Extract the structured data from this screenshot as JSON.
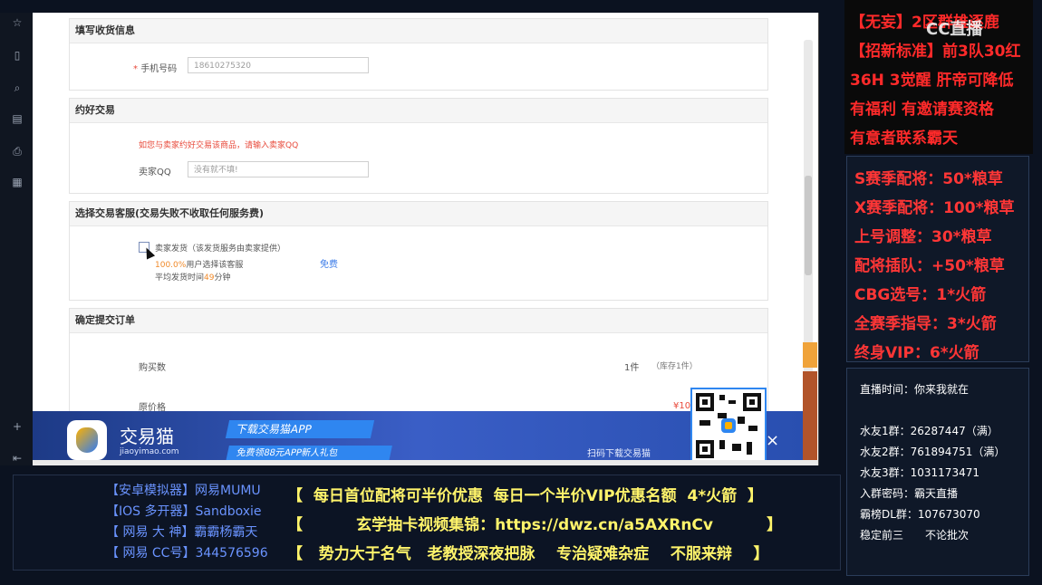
{
  "toolbar": {
    "icons": [
      "star-icon",
      "bookmark-icon",
      "search-icon",
      "document-icon",
      "print-icon",
      "note-icon",
      "plus-icon",
      "collapse-icon"
    ]
  },
  "form": {
    "shipping_title": "填写收货信息",
    "phone_label": "手机号码",
    "phone_value": "18610275320",
    "deal_title": "约好交易",
    "deal_hint": "如您与卖家约好交易该商品，请输入卖家QQ",
    "seller_qq_label": "卖家QQ",
    "seller_qq_placeholder": "没有就不填!",
    "service_title": "选择交易客服(交易失败不收取任何服务费)",
    "service_option": "卖家发货（该发货服务由卖家提供）",
    "service_rate": "100.0%",
    "service_rate_text": "用户选择该客服",
    "service_time_prefix": "平均发货时间",
    "service_time_value": "49",
    "service_time_unit": "分钟",
    "service_fee": "免费",
    "confirm_title": "确定提交订单",
    "qty_label": "购买数",
    "qty_value": "1件",
    "stock_text": "（库存1件）",
    "orig_price_label": "原价格",
    "price_partial": "¥10"
  },
  "ad": {
    "brand": "交易猫",
    "domain": "jiaoyimao.com",
    "tag_download": "下载交易猫APP",
    "tag_gift": "免费领88元APP新人礼包",
    "scan_text": "扫码下载交易猫",
    "close": "×"
  },
  "right_top": {
    "logo": "CC直播",
    "lines": [
      "【无妄】2区群雄逐鹿",
      "【招新标准】前3队30红",
      "36H 3觉醒 肝帝可降低",
      "有福利 有邀请赛资格",
      "有意者联系霸天"
    ]
  },
  "right_mid": {
    "lines": [
      "S赛季配将：50*粮草",
      "X赛季配将：100*粮草",
      "上号调整：30*粮草",
      "配将插队：+50*粮草",
      "CBG选号：1*火箭",
      "全赛季指导：3*火箭",
      "终身VIP：6*火箭"
    ]
  },
  "right_bot": {
    "lines": [
      "直播时间：你来我就在",
      "",
      "水友1群：26287447（满）",
      "水友2群：761894751（满）",
      "水友3群：1031173471",
      "入群密码：霸天直播",
      "霸榜DL群：107673070",
      "稳定前三　　不论批次"
    ]
  },
  "bottom": {
    "left": [
      "【安卓模拟器】网易MUMU",
      "【IOS 多开器】Sandboxie",
      "【 网易  大 神】霸霸杨霸天",
      "【 网易  CC号】344576596"
    ],
    "center": [
      "【  每日首位配将可半价优惠  每日一个半价VIP优惠名额  4*火箭  】",
      "【          玄学抽卡视频集锦：https://dwz.cn/a5AXRnCv          】",
      "【   势力大于名气   老教授深夜把脉    专治疑难杂症    不服来辩    】"
    ]
  }
}
